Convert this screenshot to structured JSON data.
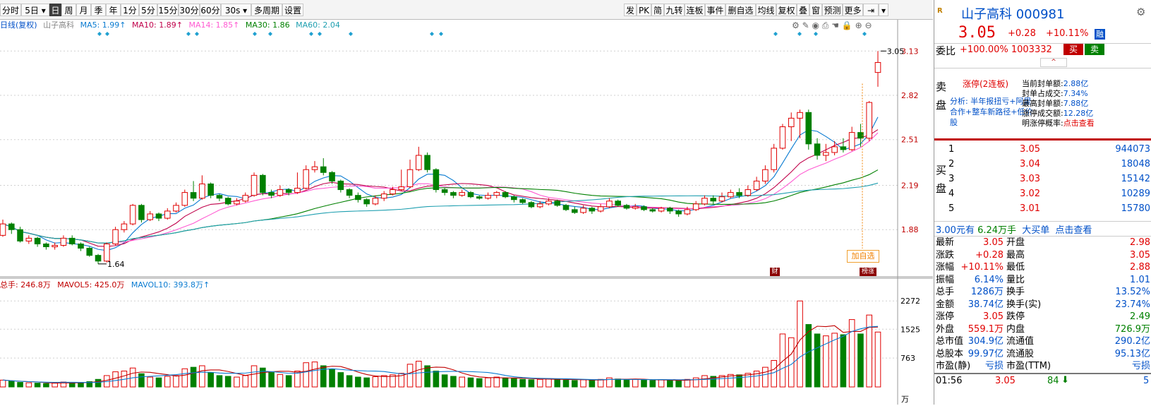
{
  "toolbar": {
    "left": [
      "分时",
      "5日",
      "日",
      "周",
      "月",
      "季",
      "年",
      "1分",
      "5分",
      "15分",
      "30分",
      "60分",
      "30s",
      "多周期",
      "设置"
    ],
    "right": [
      "发",
      "PK",
      "简",
      "九转",
      "连板",
      "事件",
      "删自选",
      "均线",
      "复权",
      "叠",
      "窗",
      "预测",
      "更多"
    ]
  },
  "ma_legend": {
    "title": "日线(复权)",
    "stock": "山子高科",
    "ma5": "MA5: 1.99↑",
    "ma10": "MA10: 1.89↑",
    "ma14": "MA14: 1.85↑",
    "ma30": "MA30: 1.86",
    "ma60": "MA60: 2.04",
    "colors": {
      "title": "#0050c8",
      "ma5": "#0a7bd1",
      "ma10": "#c0004a",
      "ma14": "#ff5ad2",
      "ma30": "#008000",
      "ma60": "#1f9fb0"
    }
  },
  "vol_legend": {
    "total": "总手: 246.8万",
    "mavol5": "MAVOL5: 425.0万",
    "mavol10": "MAVOL10: 393.8万↑"
  },
  "chart_data": {
    "type": "candlestick",
    "y_ticks": [
      "3.13",
      "2.82",
      "2.51",
      "2.19",
      "1.88"
    ],
    "ylim": [
      1.55,
      3.25
    ],
    "vol_ticks": [
      "2272",
      "1525",
      "763"
    ],
    "vol_unit": "万",
    "vol_max": 2500,
    "last_price_label": "3.05",
    "low_label": "1.64",
    "badges": [
      "加自选",
      "财",
      "榜涨"
    ],
    "candles": [
      [
        1.84,
        1.92,
        1.95,
        1.83
      ],
      [
        1.92,
        1.88,
        1.93,
        1.85
      ],
      [
        1.88,
        1.8,
        1.9,
        1.79
      ],
      [
        1.8,
        1.82,
        1.84,
        1.78
      ],
      [
        1.82,
        1.78,
        1.83,
        1.76
      ],
      [
        1.78,
        1.76,
        1.79,
        1.74
      ],
      [
        1.76,
        1.77,
        1.79,
        1.74
      ],
      [
        1.77,
        1.82,
        1.84,
        1.76
      ],
      [
        1.82,
        1.78,
        1.84,
        1.77
      ],
      [
        1.78,
        1.75,
        1.79,
        1.73
      ],
      [
        1.75,
        1.7,
        1.76,
        1.69
      ],
      [
        1.7,
        1.66,
        1.71,
        1.64
      ],
      [
        1.66,
        1.78,
        1.79,
        1.65
      ],
      [
        1.78,
        1.88,
        1.9,
        1.77
      ],
      [
        1.88,
        1.92,
        1.94,
        1.86
      ],
      [
        1.92,
        2.05,
        2.06,
        1.91
      ],
      [
        2.05,
        1.95,
        2.06,
        1.93
      ],
      [
        1.95,
        1.99,
        2.01,
        1.94
      ],
      [
        1.99,
        1.96,
        2.0,
        1.94
      ],
      [
        1.96,
        2.01,
        2.03,
        1.95
      ],
      [
        2.01,
        2.05,
        2.07,
        2.0
      ],
      [
        2.05,
        2.14,
        2.16,
        2.04
      ],
      [
        2.14,
        2.1,
        2.22,
        2.08
      ],
      [
        2.1,
        2.2,
        2.26,
        2.09
      ],
      [
        2.2,
        2.12,
        2.21,
        2.1
      ],
      [
        2.12,
        2.1,
        2.13,
        2.08
      ],
      [
        2.1,
        2.06,
        2.11,
        2.05
      ],
      [
        2.06,
        2.08,
        2.1,
        2.05
      ],
      [
        2.08,
        2.12,
        2.14,
        2.07
      ],
      [
        2.12,
        2.26,
        2.28,
        2.11
      ],
      [
        2.26,
        2.14,
        2.27,
        2.12
      ],
      [
        2.14,
        2.12,
        2.16,
        2.1
      ],
      [
        2.12,
        2.16,
        2.19,
        2.11
      ],
      [
        2.16,
        2.14,
        2.17,
        2.12
      ],
      [
        2.14,
        2.17,
        2.28,
        2.13
      ],
      [
        2.17,
        2.3,
        2.33,
        2.16
      ],
      [
        2.3,
        2.32,
        2.36,
        2.28
      ],
      [
        2.32,
        2.28,
        2.38,
        2.26
      ],
      [
        2.28,
        2.22,
        2.29,
        2.2
      ],
      [
        2.22,
        2.16,
        2.23,
        2.14
      ],
      [
        2.16,
        2.12,
        2.17,
        2.1
      ],
      [
        2.12,
        2.09,
        2.14,
        2.07
      ],
      [
        2.09,
        2.06,
        2.1,
        2.04
      ],
      [
        2.06,
        2.1,
        2.12,
        2.05
      ],
      [
        2.1,
        2.13,
        2.15,
        2.08
      ],
      [
        2.13,
        2.16,
        2.18,
        2.12
      ],
      [
        2.16,
        2.18,
        2.3,
        2.15
      ],
      [
        2.18,
        2.3,
        2.37,
        2.17
      ],
      [
        2.3,
        2.4,
        2.46,
        2.29
      ],
      [
        2.4,
        2.3,
        2.42,
        2.28
      ],
      [
        2.3,
        2.16,
        2.31,
        2.14
      ],
      [
        2.16,
        2.14,
        2.17,
        2.12
      ],
      [
        2.14,
        2.12,
        2.15,
        2.1
      ],
      [
        2.12,
        2.14,
        2.16,
        2.11
      ],
      [
        2.14,
        2.11,
        2.15,
        2.1
      ],
      [
        2.11,
        2.1,
        2.12,
        2.09
      ],
      [
        2.1,
        2.12,
        2.14,
        2.09
      ],
      [
        2.12,
        2.14,
        2.15,
        2.1
      ],
      [
        2.14,
        2.11,
        2.15,
        2.1
      ],
      [
        2.11,
        2.09,
        2.12,
        2.07
      ],
      [
        2.09,
        2.07,
        2.1,
        2.06
      ],
      [
        2.07,
        2.04,
        2.08,
        2.03
      ],
      [
        2.04,
        2.06,
        2.08,
        2.03
      ],
      [
        2.06,
        2.08,
        2.1,
        2.05
      ],
      [
        2.08,
        2.05,
        2.09,
        2.04
      ],
      [
        2.05,
        2.02,
        2.06,
        2.01
      ],
      [
        2.02,
        2.0,
        2.04,
        1.99
      ],
      [
        2.0,
        2.03,
        2.05,
        1.99
      ],
      [
        2.03,
        2.01,
        2.04,
        1.99
      ],
      [
        2.01,
        2.04,
        2.06,
        2.0
      ],
      [
        2.04,
        2.08,
        2.1,
        2.03
      ],
      [
        2.08,
        2.05,
        2.09,
        2.04
      ],
      [
        2.05,
        2.03,
        2.06,
        2.02
      ],
      [
        2.03,
        2.04,
        2.06,
        2.02
      ],
      [
        2.04,
        2.02,
        2.05,
        2.01
      ],
      [
        2.02,
        2.01,
        2.03,
        2.0
      ],
      [
        2.01,
        2.03,
        2.04,
        2.0
      ],
      [
        2.03,
        2.01,
        2.04,
        1.99
      ],
      [
        2.01,
        1.99,
        2.02,
        1.97
      ],
      [
        1.99,
        2.02,
        2.04,
        1.98
      ],
      [
        2.02,
        2.06,
        2.08,
        2.01
      ],
      [
        2.06,
        2.1,
        2.12,
        2.05
      ],
      [
        2.1,
        2.08,
        2.12,
        2.06
      ],
      [
        2.08,
        2.11,
        2.14,
        2.07
      ],
      [
        2.11,
        2.14,
        2.16,
        2.1
      ],
      [
        2.14,
        2.12,
        2.17,
        2.1
      ],
      [
        2.12,
        2.16,
        2.19,
        2.11
      ],
      [
        2.16,
        2.22,
        2.25,
        2.15
      ],
      [
        2.22,
        2.3,
        2.33,
        2.2
      ],
      [
        2.3,
        2.45,
        2.48,
        2.28
      ],
      [
        2.45,
        2.6,
        2.62,
        2.44
      ],
      [
        2.6,
        2.66,
        2.7,
        2.5
      ],
      [
        2.66,
        2.7,
        2.72,
        2.52
      ],
      [
        2.7,
        2.48,
        2.72,
        2.44
      ],
      [
        2.48,
        2.4,
        2.52,
        2.37
      ],
      [
        2.4,
        2.42,
        2.48,
        2.36
      ],
      [
        2.42,
        2.46,
        2.5,
        2.4
      ],
      [
        2.46,
        2.44,
        2.52,
        2.42
      ],
      [
        2.44,
        2.56,
        2.6,
        2.43
      ],
      [
        2.56,
        2.52,
        2.62,
        2.46
      ],
      [
        2.52,
        2.77,
        2.78,
        2.5
      ],
      [
        2.98,
        3.05,
        3.13,
        2.88
      ]
    ],
    "volumes": [
      180,
      150,
      120,
      110,
      100,
      90,
      100,
      130,
      120,
      110,
      140,
      200,
      300,
      400,
      420,
      500,
      350,
      260,
      240,
      280,
      300,
      480,
      520,
      560,
      380,
      300,
      280,
      260,
      300,
      560,
      500,
      380,
      330,
      300,
      420,
      640,
      660,
      560,
      460,
      380,
      300,
      260,
      240,
      270,
      300,
      320,
      360,
      600,
      680,
      560,
      420,
      320,
      280,
      260,
      240,
      220,
      240,
      260,
      240,
      220,
      200,
      190,
      200,
      220,
      200,
      180,
      170,
      190,
      180,
      200,
      240,
      210,
      190,
      200,
      180,
      170,
      190,
      170,
      160,
      200,
      240,
      300,
      280,
      300,
      330,
      320,
      360,
      420,
      520,
      700,
      1400,
      1300,
      2272,
      1650,
      1400,
      1350,
      1420,
      1380,
      1780,
      1400,
      1900,
      1450
    ]
  },
  "panel": {
    "stock_name": "山子高科 000981",
    "price": "3.05",
    "change": "+0.28",
    "change_pct": "+10.11%",
    "tag": "融",
    "weibi_label": "委比",
    "weibi_value": "+100.00% 1003332",
    "buy_btn": "买",
    "sell_btn": "卖",
    "limit_title": "涨停(2连板)",
    "analysis": "分析: 半年报扭亏+阿里合作+整车新路径+低价股",
    "limit_stats": [
      {
        "label": "当前封单额:",
        "value": "2.88亿"
      },
      {
        "label": "封单占成交:",
        "value": "7.34%"
      },
      {
        "label": "最高封单额:",
        "value": "7.88亿"
      },
      {
        "label": "涨停成交额:",
        "value": "12.28亿"
      },
      {
        "label": "明涨停概率:",
        "value": "点击查看"
      }
    ],
    "sell_label": "卖盘",
    "buy_label": "买盘",
    "bids": [
      {
        "lvl": "1",
        "price": "3.05",
        "vol": "944073"
      },
      {
        "lvl": "2",
        "price": "3.04",
        "vol": "18048"
      },
      {
        "lvl": "3",
        "price": "3.03",
        "vol": "15142"
      },
      {
        "lvl": "4",
        "price": "3.02",
        "vol": "10289"
      },
      {
        "lvl": "5",
        "price": "3.01",
        "vol": "15780"
      }
    ],
    "big_order": {
      "price": "3.00元有",
      "vol": "6.24万手",
      "label": "大买单",
      "link": "点击查看"
    },
    "stats": [
      [
        "最新",
        "3.05",
        "开盘",
        "2.98"
      ],
      [
        "涨跌",
        "+0.28",
        "最高",
        "3.05"
      ],
      [
        "涨幅",
        "+10.11%",
        "最低",
        "2.88"
      ],
      [
        "振幅",
        "6.14%",
        "量比",
        "1.01"
      ],
      [
        "总手",
        "1286万",
        "换手",
        "13.52%"
      ],
      [
        "金额",
        "38.74亿",
        "换手(实)",
        "23.74%"
      ],
      [
        "涨停",
        "3.05",
        "跌停",
        "2.49"
      ],
      [
        "外盘",
        "559.1万",
        "内盘",
        "726.9万"
      ],
      [
        "总市值",
        "304.9亿",
        "流通值",
        "290.2亿"
      ],
      [
        "总股本",
        "99.97亿",
        "流通股",
        "95.13亿"
      ],
      [
        "市盈(静)",
        "亏损",
        "市盈(TTM)",
        "亏损"
      ]
    ],
    "tick": {
      "time": "01:56",
      "price": "3.05",
      "vol": "84",
      "n": "5"
    }
  }
}
